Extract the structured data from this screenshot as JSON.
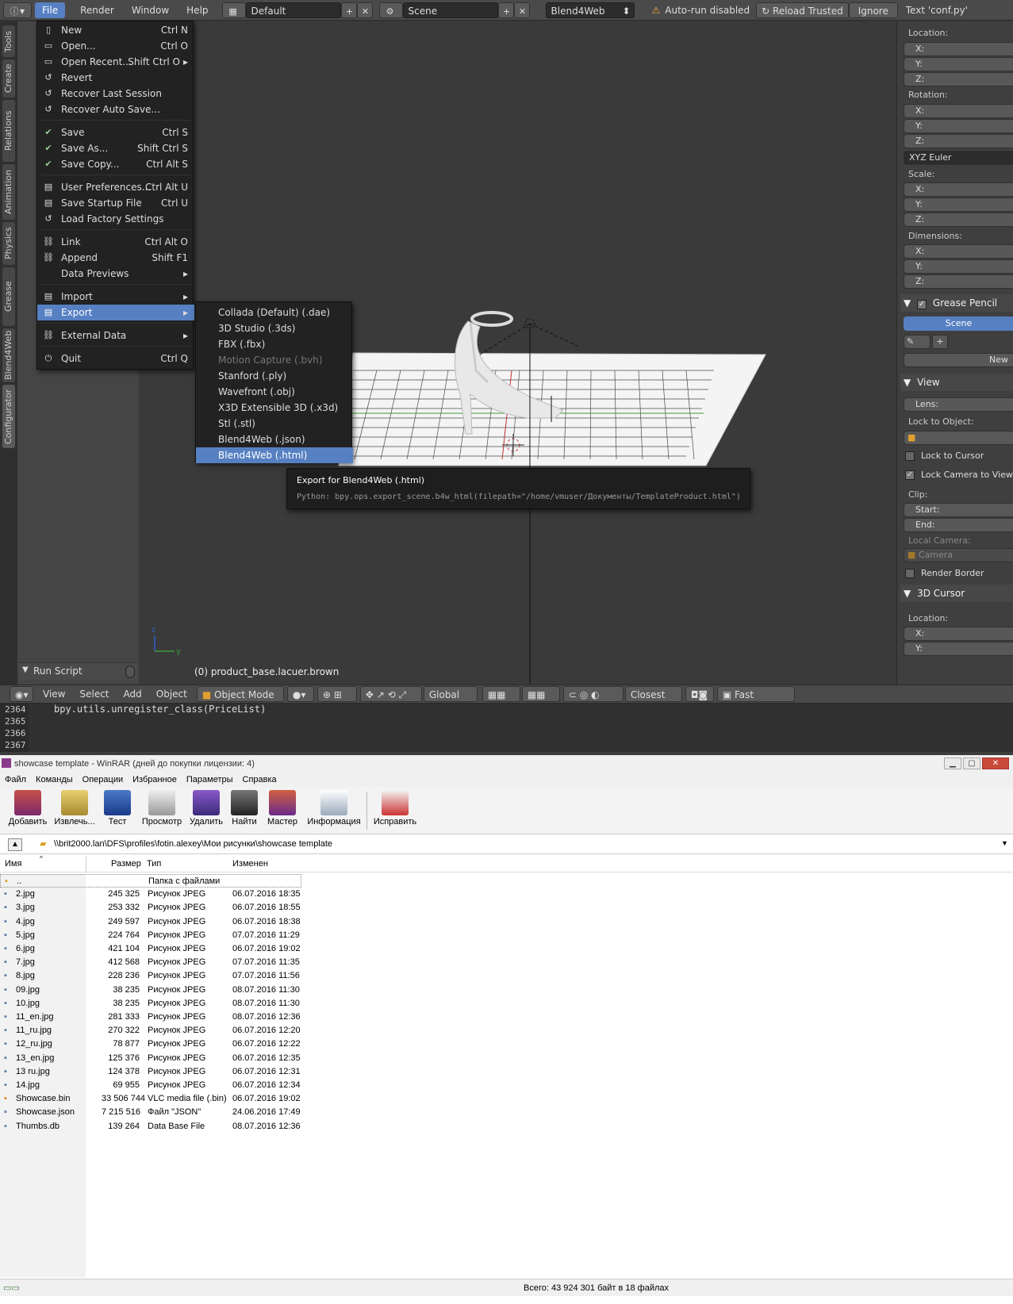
{
  "blender": {
    "top_menus": [
      "File",
      "Render",
      "Window",
      "Help"
    ],
    "screen_layout": "Default",
    "scene": "Scene",
    "engine": "Blend4Web",
    "warning": "Auto-run disabled",
    "reload_trusted": "Reload Trusted",
    "ignore": "Ignore",
    "script_note": "Text 'conf.py'",
    "left_tabs": [
      "Tools",
      "Create",
      "Relations",
      "Animation",
      "Physics",
      "Grease Pencil",
      "Blend4Web",
      "Configurator"
    ],
    "run_script": "Run Script",
    "object_label": "(0) product_base.lacuer.brown",
    "header": {
      "view": "View",
      "select": "Select",
      "add": "Add",
      "object": "Object",
      "mode": "Object Mode",
      "orientation": "Global",
      "snap": "Closest",
      "preview": "Fast Preview"
    },
    "text_editor": {
      "line_numbers": [
        "2364",
        "2365",
        "2366",
        "2367"
      ],
      "code": "bpy.utils.unregister_class(PriceList)"
    },
    "file_menu": {
      "items": [
        {
          "icon": "document-icon",
          "label": "New",
          "shortcut": "Ctrl N"
        },
        {
          "icon": "folder-open-icon",
          "label": "Open...",
          "shortcut": "Ctrl O"
        },
        {
          "icon": "folder-open-icon",
          "label": "Open Recent...",
          "shortcut": "Shift Ctrl O"
        },
        {
          "icon": "revert-icon",
          "label": "Revert",
          "shortcut": ""
        },
        {
          "icon": "recover-icon",
          "label": "Recover Last Session",
          "shortcut": ""
        },
        {
          "icon": "recover-icon",
          "label": "Recover Auto Save...",
          "shortcut": ""
        },
        {
          "icon": "checkmark-icon",
          "label": "Save",
          "shortcut": "Ctrl S"
        },
        {
          "icon": "checkmark-icon",
          "label": "Save As...",
          "shortcut": "Shift Ctrl S"
        },
        {
          "icon": "save-copy-icon",
          "label": "Save Copy...",
          "shortcut": "Ctrl Alt S"
        },
        {
          "icon": "preferences-icon",
          "label": "User Preferences...",
          "shortcut": "Ctrl Alt U"
        },
        {
          "icon": "save-startup-icon",
          "label": "Save Startup File",
          "shortcut": "Ctrl U"
        },
        {
          "icon": "factory-icon",
          "label": "Load Factory Settings",
          "shortcut": ""
        },
        {
          "icon": "link-icon",
          "label": "Link",
          "shortcut": "Ctrl Alt O"
        },
        {
          "icon": "append-icon",
          "label": "Append",
          "shortcut": "Shift F1"
        },
        {
          "icon": "",
          "label": "Data Previews",
          "shortcut": ""
        },
        {
          "icon": "import-icon",
          "label": "Import",
          "shortcut": ""
        },
        {
          "icon": "export-icon",
          "label": "Export",
          "shortcut": ""
        },
        {
          "icon": "external-data-icon",
          "label": "External Data",
          "shortcut": ""
        },
        {
          "icon": "power-icon",
          "label": "Quit",
          "shortcut": "Ctrl Q"
        }
      ]
    },
    "export_menu": [
      "Collada (Default) (.dae)",
      "3D Studio (.3ds)",
      "FBX (.fbx)",
      "Motion Capture (.bvh)",
      "Stanford (.ply)",
      "Wavefront (.obj)",
      "X3D Extensible 3D (.x3d)",
      "Stl (.stl)",
      "Blend4Web (.json)",
      "Blend4Web (.html)"
    ],
    "tooltip": {
      "title": "Export for Blend4Web (.html)",
      "python": "Python: bpy.ops.export_scene.b4w_html(filepath=\"/home/vmuser/Документы/TemplateProduct.html\")"
    },
    "right_panel": {
      "location": "Location:",
      "rotation": "Rotation:",
      "rotation_mode": "XYZ Euler",
      "scale": "Scale:",
      "dimensions": "Dimensions:",
      "x": "X:",
      "y": "Y:",
      "z": "Z:",
      "grease_pencil": "Grease Pencil",
      "scene_btn": "Scene",
      "new_btn": "New",
      "view": "View",
      "lens": "Lens:",
      "lock_to_object": "Lock to Object:",
      "lock_to_cursor": "Lock to Cursor",
      "lock_camera": "Lock Camera to View",
      "clip": "Clip:",
      "start": "Start:",
      "end": "End:",
      "local_camera": "Local Camera:",
      "camera": "Camera",
      "render_border": "Render Border",
      "cursor": "3D Cursor",
      "cursor_location": "Location:"
    }
  },
  "winrar": {
    "title": "showcase template - WinRAR (дней до покупки лицензии: 4)",
    "menu": [
      "Файл",
      "Команды",
      "Операции",
      "Избранное",
      "Параметры",
      "Справка"
    ],
    "tools": [
      "Добавить",
      "Извлечь...",
      "Тест",
      "Просмотр",
      "Удалить",
      "Найти",
      "Мастер",
      "Информация",
      "Исправить"
    ],
    "path": "\\\\brit2000.lan\\DFS\\profiles\\fotin.alexey\\Мои рисунки\\showcase template",
    "columns": [
      "Имя",
      "Размер",
      "Тип",
      "Изменен"
    ],
    "files": [
      {
        "name": "..",
        "size": "",
        "type": "Папка с файлами",
        "modified": ""
      },
      {
        "name": "2.jpg",
        "size": "245 325",
        "type": "Рисунок JPEG",
        "modified": "06.07.2016 18:35"
      },
      {
        "name": "3.jpg",
        "size": "253 332",
        "type": "Рисунок JPEG",
        "modified": "06.07.2016 18:55"
      },
      {
        "name": "4.jpg",
        "size": "249 597",
        "type": "Рисунок JPEG",
        "modified": "06.07.2016 18:38"
      },
      {
        "name": "5.jpg",
        "size": "224 764",
        "type": "Рисунок JPEG",
        "modified": "07.07.2016 11:29"
      },
      {
        "name": "6.jpg",
        "size": "421 104",
        "type": "Рисунок JPEG",
        "modified": "06.07.2016 19:02"
      },
      {
        "name": "7.jpg",
        "size": "412 568",
        "type": "Рисунок JPEG",
        "modified": "07.07.2016 11:35"
      },
      {
        "name": "8.jpg",
        "size": "228 236",
        "type": "Рисунок JPEG",
        "modified": "07.07.2016 11:56"
      },
      {
        "name": "09.jpg",
        "size": "38 235",
        "type": "Рисунок JPEG",
        "modified": "08.07.2016 11:30"
      },
      {
        "name": "10.jpg",
        "size": "38 235",
        "type": "Рисунок JPEG",
        "modified": "08.07.2016 11:30"
      },
      {
        "name": "11_en.jpg",
        "size": "281 333",
        "type": "Рисунок JPEG",
        "modified": "08.07.2016 12:36"
      },
      {
        "name": "11_ru.jpg",
        "size": "270 322",
        "type": "Рисунок JPEG",
        "modified": "06.07.2016 12:20"
      },
      {
        "name": "12_ru.jpg",
        "size": "78 877",
        "type": "Рисунок JPEG",
        "modified": "06.07.2016 12:22"
      },
      {
        "name": "13_en.jpg",
        "size": "125 376",
        "type": "Рисунок JPEG",
        "modified": "06.07.2016 12:35"
      },
      {
        "name": "13 ru.jpg",
        "size": "124 378",
        "type": "Рисунок JPEG",
        "modified": "06.07.2016 12:31"
      },
      {
        "name": "14.jpg",
        "size": "69 955",
        "type": "Рисунок JPEG",
        "modified": "06.07.2016 12:34"
      },
      {
        "name": "Showcase.bin",
        "size": "33 506 744",
        "type": "VLC media file (.bin)",
        "modified": "06.07.2016 19:02"
      },
      {
        "name": "Showcase.json",
        "size": "7 215 516",
        "type": "Файл \"JSON\"",
        "modified": "24.06.2016 17:49"
      },
      {
        "name": "Thumbs.db",
        "size": "139 264",
        "type": "Data Base File",
        "modified": "08.07.2016 12:36"
      }
    ],
    "status": "Всего: 43 924 301 байт в 18 файлах"
  }
}
